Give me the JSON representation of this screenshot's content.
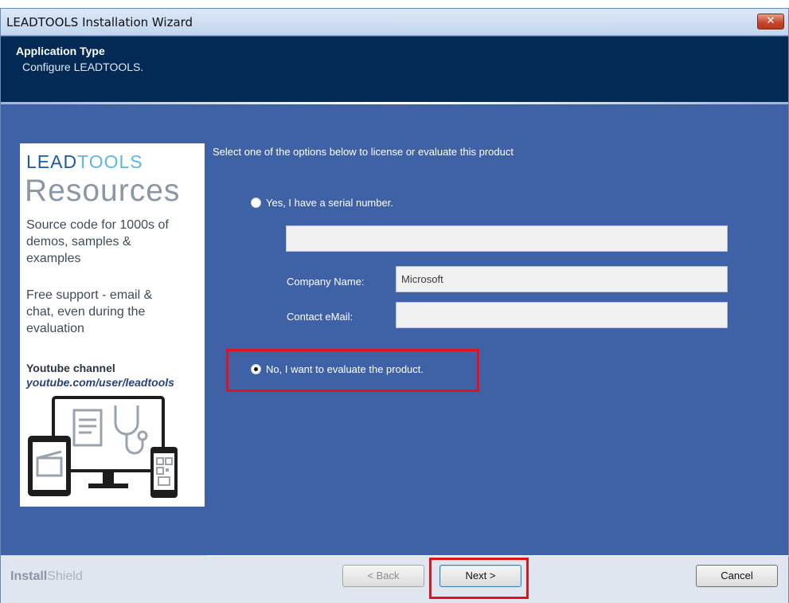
{
  "window": {
    "title": "LEADTOOLS Installation Wizard",
    "close_glyph": "✕",
    "header_title": "Application Type",
    "header_subtitle": "Configure LEADTOOLS.",
    "instruction": "Select one of the options below to license or evaluate this product"
  },
  "promo": {
    "brand_lead": "LEAD",
    "brand_tools": "TOOLS",
    "heading": "Resources",
    "line1": "Source code for 1000s of",
    "line2": "demos, samples &",
    "line3": "examples",
    "line4": "Free support - email &",
    "line5": "chat, even during the",
    "line6": "evaluation",
    "youtube_label": "Youtube channel",
    "youtube_url": "youtube.com/user/leadtools",
    "illustration": "devices-icon"
  },
  "options": {
    "serial": {
      "label": "Yes, I have a serial number.",
      "checked": false
    },
    "evaluate": {
      "label": "No, I want to evaluate the  product.",
      "checked": true
    }
  },
  "fields": {
    "serial_value": "",
    "company_label": "Company Name:",
    "company_value": "Microsoft",
    "email_label": "Contact eMail:",
    "email_value": ""
  },
  "footer": {
    "brand_install": "Install",
    "brand_shield": "Shield",
    "back_label": "< Back",
    "next_label": "Next >",
    "cancel_label": "Cancel"
  },
  "colors": {
    "header_bg": "#032a55",
    "body_bg": "#3f62a6",
    "highlight": "#e0121b"
  }
}
